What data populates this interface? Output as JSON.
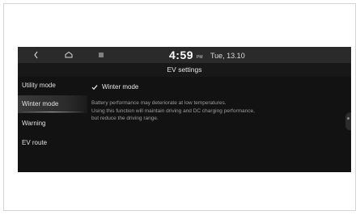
{
  "status_bar": {
    "time": "4:59",
    "ampm": "PM",
    "date": "Tue, 13.10"
  },
  "header": {
    "title": "EV settings"
  },
  "sidebar": {
    "items": [
      {
        "label": "Utility mode",
        "active": false
      },
      {
        "label": "Winter mode",
        "active": true
      },
      {
        "label": "Warning",
        "active": false
      },
      {
        "label": "EV route",
        "active": false
      }
    ]
  },
  "winter_mode": {
    "checkbox_label": "Winter mode",
    "checked": true,
    "description_lines": [
      "Battery performance may deteriorate at low temperatures.",
      "Using this function will maintain driving and DC charging performance,",
      "but reduce the driving range."
    ]
  },
  "icons": {
    "back": "back-chevron-icon",
    "home": "home-icon",
    "menu": "menu-icon",
    "check": "checkmark-icon"
  },
  "colors": {
    "screen_bg": "#121212",
    "top_bar": "#2a2a2a",
    "text_primary": "#e6e6e6",
    "text_secondary": "#9c9c9c"
  }
}
